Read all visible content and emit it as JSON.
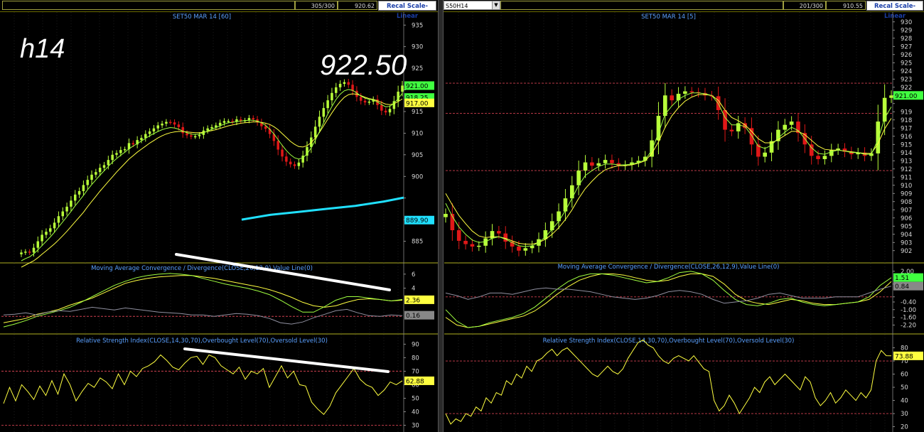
{
  "left": {
    "toolbar": {
      "box1": "",
      "box2": "305/300",
      "box3": "920.62",
      "button": "Recal Scale-Linear"
    },
    "annotation_big": "h14",
    "annotation_price": "922.50"
  },
  "right": {
    "toolbar": {
      "symbol": "S50H14",
      "box1": "",
      "box2": "201/300",
      "box3": "910.55",
      "button": "Recal Scale-Linear"
    }
  },
  "colors": {
    "up": "#b8ff3a",
    "down": "#e01818",
    "ma_yellow": "#ffff40",
    "ma_green": "#a0ff40",
    "cyan": "#20e0ff",
    "trendline": "#ffffff",
    "dashed": "#d04050",
    "label_blue": "#5aa0ff"
  },
  "chart_data": [
    {
      "type": "candlestick",
      "panel": "left-price",
      "title": "SET50 MAR 14  [60]",
      "ylim": [
        880,
        938
      ],
      "ticks": [
        885,
        890,
        895,
        900,
        905,
        910,
        915,
        920,
        925,
        930,
        935
      ],
      "tick_labels": [
        "885",
        "",
        "",
        "900",
        "905",
        "910",
        "915",
        "",
        "925",
        "930",
        "935"
      ],
      "labels": [
        {
          "text": "921.00",
          "y": 921.0,
          "color": "#40ff40"
        },
        {
          "text": "918.25",
          "y": 918.25,
          "color": "#40ff40"
        },
        {
          "text": "917.00",
          "y": 917.0,
          "color": "#ffff40"
        },
        {
          "text": "889.90",
          "y": 889.9,
          "color": "#20e0ff"
        }
      ],
      "closes": [
        882.4,
        882.6,
        882.4,
        883.5,
        885,
        886.5,
        887.2,
        888.0,
        889.3,
        890.8,
        891.9,
        893.0,
        894.4,
        895.8,
        896.6,
        898.0,
        899.2,
        900.4,
        901.0,
        902.0,
        902.6,
        903.8,
        905.0,
        905.4,
        906.1,
        906.3,
        907.7,
        907.4,
        908.4,
        908.9,
        909.8,
        910.4,
        911.1,
        911.8,
        912.2,
        912.6,
        912.5,
        912.0,
        911.4,
        910.0,
        909.5,
        909.2,
        909.3,
        909.6,
        910.6,
        911.1,
        911.4,
        911.8,
        912.4,
        912.8,
        912.8,
        912.6,
        913.2,
        912.9,
        913.0,
        913.5,
        913.2,
        912.5,
        911.6,
        911.0,
        909.8,
        908.2,
        906.2,
        904.6,
        903.4,
        902.8,
        902.4,
        903.2,
        904.8,
        906.8,
        909.0,
        911.5,
        913.8,
        915.8,
        917.6,
        919.3,
        920.6,
        921.4,
        921.8,
        921.2,
        919.8,
        918.4,
        917.5,
        917.1,
        917.3,
        917.8,
        916.5,
        915.2,
        914.8,
        915.6,
        917.4,
        919.6,
        921.0
      ],
      "ma_yellow": [
        879,
        879.5,
        880,
        880.5,
        881.2,
        882,
        882.8,
        883.6,
        884.4,
        885.3,
        886.3,
        887.3,
        888.4,
        889.5,
        890.6,
        891.7,
        893,
        894.2,
        895.4,
        896.6,
        897.7,
        898.8,
        899.9,
        901,
        902,
        903,
        904,
        904.8,
        905.6,
        906.3,
        907,
        907.7,
        908.3,
        908.9,
        909.4,
        909.8,
        910.1,
        910.3,
        910.4,
        910.4,
        910.3,
        910.2,
        910.1,
        910.1,
        910.2,
        910.4,
        910.6,
        910.8,
        911.1,
        911.4,
        911.7,
        911.9,
        912.1,
        912.3,
        912.4,
        912.5,
        912.6,
        912.6,
        912.5,
        912.3,
        912,
        911.5,
        910.8,
        909.9,
        909,
        908.1,
        907.4,
        906.9,
        906.8,
        907.1,
        907.8,
        908.9,
        910.2,
        911.7,
        913.2,
        914.7,
        916.1,
        917.3,
        918.3,
        918.9,
        919.1,
        919.0,
        918.7,
        918.3,
        918.0,
        917.8,
        917.5,
        917.1,
        916.7,
        916.6,
        916.8,
        917.3,
        917.9
      ],
      "ma_green": [
        880.5,
        881,
        881.4,
        882.1,
        883,
        884,
        885,
        886,
        887.1,
        888.3,
        889.5,
        890.7,
        891.9,
        893.2,
        894.4,
        895.6,
        896.9,
        898.1,
        899.2,
        900.3,
        901.3,
        902.3,
        903.3,
        904.1,
        904.9,
        905.6,
        906.4,
        907,
        907.6,
        908.2,
        908.8,
        909.4,
        909.9,
        910.4,
        910.8,
        911.1,
        911.3,
        911.2,
        910.9,
        910.5,
        910.1,
        909.8,
        909.7,
        909.8,
        910.1,
        910.5,
        910.9,
        911.3,
        911.7,
        912.1,
        912.4,
        912.5,
        912.7,
        912.8,
        912.9,
        913,
        913,
        912.8,
        912.4,
        911.8,
        910.9,
        909.8,
        908.5,
        907.2,
        906,
        905,
        904.3,
        904.0,
        904.3,
        905.2,
        906.6,
        908.4,
        910.4,
        912.4,
        914.4,
        916.2,
        917.8,
        919,
        919.8,
        920.1,
        919.9,
        919.3,
        918.6,
        918.1,
        917.8,
        917.7,
        917.2,
        916.6,
        916.1,
        916.2,
        916.9,
        918.0,
        919.2
      ],
      "cyan_line": [
        [
          340,
          890
        ],
        [
          380,
          891.1
        ],
        [
          420,
          891.8
        ],
        [
          460,
          892.5
        ],
        [
          500,
          893.2
        ],
        [
          540,
          894.2
        ],
        [
          568,
          895.1
        ]
      ]
    },
    {
      "type": "line",
      "panel": "left-macd",
      "title": "Moving Average Convergence / Divergence(CLOSE,26,12,9),Value Line(0)",
      "ylim": [
        -2.5,
        7.5
      ],
      "ticks": [
        6,
        4
      ],
      "labels": [
        {
          "text": "2.36",
          "y": 2.36,
          "color": "#ffff40"
        },
        {
          "text": "0.16",
          "y": 0.16,
          "color": "#888888"
        }
      ],
      "series": [
        {
          "color": "#ffff40",
          "values": [
            -0.9,
            -0.6,
            -0.3,
            0.3,
            0.6,
            1,
            1.6,
            2.1,
            2.6,
            3.3,
            4.0,
            4.7,
            5.1,
            5.4,
            5.6,
            5.7,
            5.8,
            5.8,
            5.6,
            5.4,
            5.1,
            4.8,
            4.5,
            4.2,
            3.8,
            3.3,
            2.7,
            2.0,
            1.5,
            1.3,
            1.5,
            2.0,
            2.4,
            2.5,
            2.4,
            2.2,
            2.3
          ]
        },
        {
          "color": "#a0ff40",
          "values": [
            -1.5,
            -1.1,
            -0.6,
            0.0,
            0.4,
            0.8,
            1.3,
            2.0,
            2.8,
            3.6,
            4.4,
            5.0,
            5.5,
            5.8,
            6.0,
            6.1,
            6.0,
            5.8,
            5.4,
            5.0,
            4.6,
            4.3,
            4.0,
            3.6,
            3.1,
            2.3,
            1.4,
            0.6,
            0.6,
            1.4,
            2.3,
            2.8,
            2.8,
            2.6,
            2.4,
            2.2,
            2.4
          ]
        },
        {
          "color": "#9090a0",
          "values": [
            0.2,
            0.3,
            0.5,
            0.2,
            0.6,
            0.8,
            0.7,
            1.0,
            1.3,
            1.1,
            0.9,
            1.2,
            1.0,
            0.8,
            0.6,
            0.5,
            0.4,
            0.2,
            0.2,
            0.0,
            0.2,
            0.4,
            0.3,
            0.1,
            -0.3,
            -0.9,
            -1.1,
            -0.8,
            -0.2,
            0.3,
            0.8,
            1.0,
            0.5,
            0.1,
            0.0,
            0.2,
            0.1
          ]
        }
      ]
    },
    {
      "type": "line",
      "panel": "left-rsi",
      "title": "Relative Strength Index(CLOSE,14,30,70),Overbought Level(70),Oversold Level(30)",
      "ylim": [
        25,
        97
      ],
      "ticks": [
        90,
        80,
        70,
        60,
        50,
        40,
        30
      ],
      "labels": [
        {
          "text": "62.88",
          "y": 62.88,
          "color": "#ffff40"
        }
      ],
      "values": [
        46,
        58,
        48,
        60,
        55,
        49,
        59,
        52,
        63,
        53,
        68,
        60,
        48,
        55,
        61,
        58,
        65,
        62,
        57,
        68,
        60,
        70,
        66,
        72,
        74,
        77,
        82,
        78,
        73,
        71,
        76,
        80,
        81,
        75,
        82,
        80,
        74,
        71,
        68,
        73,
        64,
        70,
        68,
        72,
        58,
        66,
        74,
        65,
        70,
        60,
        59,
        47,
        42,
        38,
        44,
        54,
        60,
        66,
        72,
        64,
        60,
        58,
        52,
        56,
        62,
        60,
        62.88
      ]
    },
    {
      "type": "candlestick",
      "panel": "right-price",
      "title": "SET50 MAR 14  [5]",
      "ylim": [
        900.5,
        931.2
      ],
      "ticks": [
        902,
        903,
        904,
        905,
        906,
        907,
        908,
        909,
        910,
        911,
        912,
        913,
        914,
        915,
        916,
        917,
        918,
        919,
        920,
        921,
        922,
        923,
        924,
        925,
        926,
        927,
        928,
        929,
        930
      ],
      "tick_labels": [
        "902",
        "903",
        "904",
        "905",
        "906",
        "907",
        "908",
        "909",
        "910",
        "911",
        "912",
        "913",
        "914",
        "915",
        "916",
        "917",
        "918",
        "919",
        "",
        "921",
        "922",
        "923",
        "924",
        "925",
        "926",
        "927",
        "928",
        "929",
        "930"
      ],
      "labels": [
        {
          "text": "921.00",
          "y": 921.0,
          "color": "#40ff40"
        }
      ],
      "dashed_levels": [
        922.5,
        918.8,
        911.8
      ],
      "closes": [
        906.5,
        904.5,
        903.2,
        902.8,
        902.5,
        902.6,
        903.5,
        904.4,
        904.1,
        903.1,
        902.5,
        902.0,
        902.3,
        902.6,
        903.4,
        904.5,
        905.6,
        906.8,
        908.4,
        910.0,
        911.8,
        912.8,
        912.4,
        912.7,
        913.1,
        912.7,
        912.4,
        912.5,
        912.8,
        913.0,
        913.5,
        915.5,
        918.5,
        921.0,
        920.4,
        921.2,
        921.5,
        921.4,
        921.3,
        921.0,
        920.9,
        919.2,
        916.8,
        916.6,
        917.6,
        917.0,
        915.0,
        913.5,
        914.0,
        915.4,
        916.8,
        917.4,
        917.8,
        916.4,
        915.0,
        913.6,
        913.2,
        913.6,
        914.3,
        914.5,
        914.1,
        913.8,
        914.0,
        913.6,
        913.9,
        917.8,
        920.7,
        921.0
      ],
      "ma_yellow": [
        909,
        907.6,
        906.3,
        905.3,
        904.4,
        903.8,
        903.6,
        903.7,
        903.7,
        903.5,
        903.2,
        902.9,
        902.8,
        902.8,
        903.0,
        903.4,
        904.0,
        904.8,
        905.8,
        907.0,
        908.4,
        909.6,
        910.5,
        911.3,
        911.9,
        912.2,
        912.4,
        912.4,
        912.5,
        912.7,
        913.0,
        913.9,
        915.3,
        917.1,
        918.5,
        919.5,
        920.3,
        920.8,
        921.1,
        921.1,
        921.0,
        920.4,
        919.2,
        918.3,
        917.9,
        917.4,
        916.6,
        915.7,
        915.2,
        915.2,
        915.6,
        916.1,
        916.6,
        916.6,
        916.2,
        915.5,
        914.8,
        914.4,
        914.3,
        914.3,
        914.2,
        914.1,
        914.0,
        913.9,
        913.9,
        915.1,
        916.9,
        918.2
      ],
      "ma_green": [
        907.8,
        906.2,
        904.9,
        904.0,
        903.3,
        903.0,
        903.1,
        903.5,
        903.7,
        903.4,
        903.0,
        902.6,
        902.5,
        902.6,
        903.0,
        903.7,
        904.6,
        905.6,
        906.9,
        908.4,
        910.0,
        911.2,
        911.8,
        912.3,
        912.6,
        912.6,
        912.5,
        912.5,
        912.6,
        912.8,
        913.1,
        914.3,
        916.4,
        918.7,
        919.7,
        920.5,
        921.0,
        921.3,
        921.3,
        921.2,
        921.0,
        920.0,
        918.3,
        917.4,
        917.4,
        917.2,
        916.1,
        914.8,
        914.5,
        914.9,
        915.8,
        916.5,
        917.1,
        916.7,
        915.7,
        914.6,
        913.9,
        913.8,
        914.1,
        914.3,
        914.2,
        914.0,
        914.0,
        913.8,
        913.8,
        915.6,
        918.2,
        919.6
      ]
    },
    {
      "type": "line",
      "panel": "right-macd",
      "title": "Moving Average Convergence / Divergence(CLOSE,26,12,9),Value Line(0)",
      "ylim": [
        -2.9,
        2.6
      ],
      "ticks": [
        2.0,
        1.0,
        0.0,
        -0.4,
        -1.0,
        -1.6,
        -2.2
      ],
      "tick_labels": [
        "2.00",
        "",
        "",
        "-0.40",
        "-1.00",
        "-1.60",
        "-2.20"
      ],
      "labels": [
        {
          "text": "1.51",
          "y": 1.51,
          "color": "#40ff40"
        },
        {
          "text": "0.84",
          "y": 0.84,
          "color": "#888888"
        }
      ],
      "series": [
        {
          "color": "#ffff40",
          "values": [
            -1.6,
            -2.2,
            -2.4,
            -2.3,
            -2.1,
            -1.9,
            -1.7,
            -1.5,
            -1.1,
            -0.5,
            0.2,
            0.8,
            1.3,
            1.6,
            1.8,
            1.8,
            1.7,
            1.5,
            1.3,
            1.2,
            1.3,
            1.6,
            1.8,
            1.8,
            1.6,
            1.0,
            0.2,
            -0.3,
            -0.5,
            -0.6,
            -0.4,
            -0.2,
            -0.3,
            -0.5,
            -0.6,
            -0.6,
            -0.5,
            -0.4,
            -0.2,
            0.4,
            1.2
          ]
        },
        {
          "color": "#a0ff40",
          "values": [
            -1.0,
            -1.9,
            -2.4,
            -2.3,
            -2.0,
            -1.8,
            -1.6,
            -1.3,
            -0.8,
            -0.1,
            0.6,
            1.2,
            1.6,
            1.8,
            1.8,
            1.7,
            1.5,
            1.3,
            1.1,
            1.2,
            1.5,
            1.9,
            2.0,
            1.8,
            1.3,
            0.5,
            -0.2,
            -0.6,
            -0.7,
            -0.5,
            -0.2,
            -0.1,
            -0.4,
            -0.6,
            -0.7,
            -0.6,
            -0.5,
            -0.4,
            0.0,
            0.9,
            1.5
          ]
        },
        {
          "color": "#9090a0",
          "values": [
            0.3,
            0.1,
            -0.2,
            0.0,
            0.3,
            0.3,
            0.2,
            0.4,
            0.6,
            0.7,
            0.6,
            0.6,
            0.5,
            0.4,
            0.2,
            0.0,
            -0.1,
            -0.2,
            -0.1,
            0.1,
            0.4,
            0.5,
            0.4,
            0.2,
            -0.2,
            -0.5,
            -0.4,
            -0.3,
            -0.1,
            0.2,
            0.3,
            0.1,
            -0.1,
            -0.1,
            -0.1,
            0.0,
            0.0,
            0.0,
            0.3,
            0.6,
            0.84
          ]
        }
      ]
    },
    {
      "type": "line",
      "panel": "right-rsi",
      "title": "Relative Strength Index(CLOSE,14,30,70),Overbought Level(70),Oversold Level(30)",
      "ylim": [
        16,
        90
      ],
      "ticks": [
        80,
        70,
        60,
        50,
        40,
        30,
        20
      ],
      "labels": [
        {
          "text": "73.88",
          "y": 73.88,
          "color": "#ffff40"
        }
      ],
      "values": [
        30,
        22,
        26,
        24,
        30,
        28,
        35,
        32,
        42,
        38,
        46,
        44,
        55,
        52,
        60,
        57,
        66,
        62,
        70,
        72,
        76,
        79,
        74,
        78,
        80,
        76,
        72,
        68,
        64,
        60,
        58,
        62,
        66,
        62,
        60,
        64,
        72,
        78,
        84,
        86,
        82,
        80,
        74,
        70,
        68,
        72,
        74,
        72,
        70,
        74,
        69,
        64,
        62,
        40,
        32,
        36,
        44,
        38,
        30,
        36,
        42,
        50,
        46,
        54,
        58,
        52,
        56,
        60,
        56,
        52,
        48,
        58,
        54,
        42,
        36,
        40,
        46,
        38,
        42,
        48,
        44,
        40,
        46,
        42,
        48,
        70,
        78,
        74,
        73.88
      ]
    }
  ]
}
